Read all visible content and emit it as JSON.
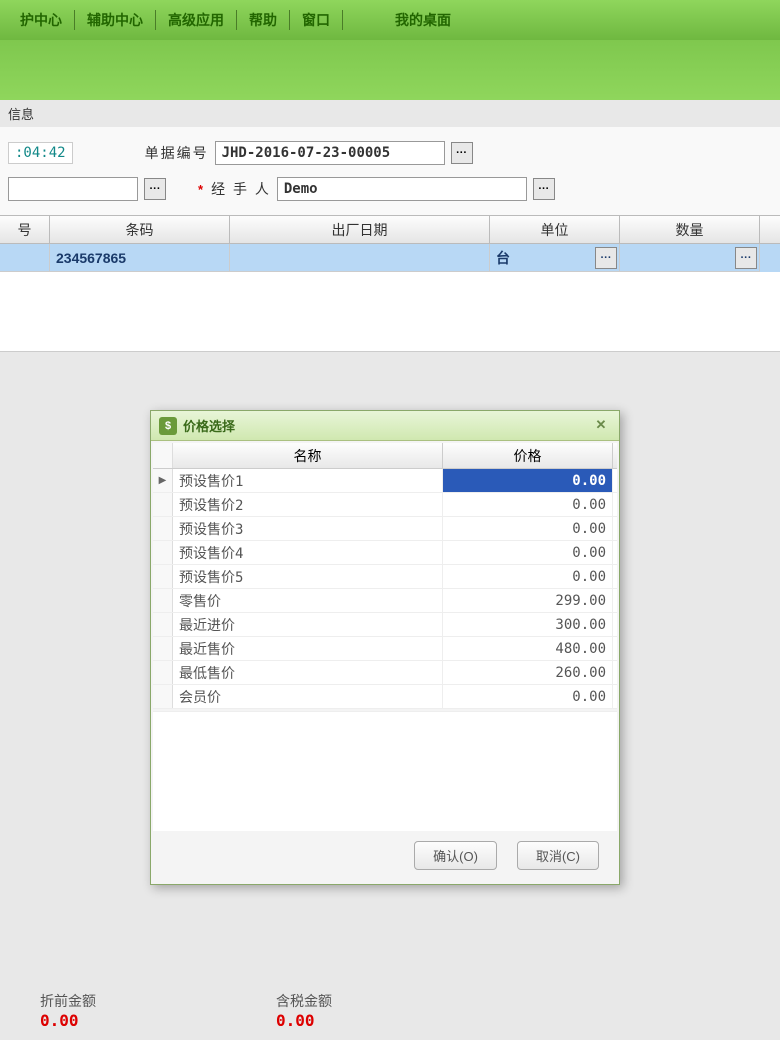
{
  "menu": {
    "items": [
      "护中心",
      "辅助中心",
      "高级应用",
      "帮助",
      "窗口",
      "我的桌面"
    ]
  },
  "info_label": "信息",
  "header": {
    "time": ":04:42",
    "doc_no_label": "单据编号",
    "doc_no_value": "JHD-2016-07-23-00005",
    "handler_label": "经 手 人",
    "handler_value": "Demo"
  },
  "grid": {
    "columns": [
      "号",
      "条码",
      "出厂日期",
      "单位",
      "数量"
    ],
    "row": {
      "barcode": "234567865",
      "mfg_date": "",
      "unit": "台",
      "qty": ""
    }
  },
  "dialog": {
    "title": "价格选择",
    "columns": [
      "名称",
      "价格"
    ],
    "rows": [
      {
        "name": "预设售价1",
        "price": "0.00",
        "selected": true
      },
      {
        "name": "预设售价2",
        "price": "0.00"
      },
      {
        "name": "预设售价3",
        "price": "0.00"
      },
      {
        "name": "预设售价4",
        "price": "0.00"
      },
      {
        "name": "预设售价5",
        "price": "0.00"
      },
      {
        "name": "零售价",
        "price": "299.00"
      },
      {
        "name": "最近进价",
        "price": "300.00"
      },
      {
        "name": "最近售价",
        "price": "480.00"
      },
      {
        "name": "最低售价",
        "price": "260.00"
      },
      {
        "name": "会员价",
        "price": "0.00"
      }
    ],
    "ok_label": "确认(O)",
    "cancel_label": "取消(C)"
  },
  "totals": {
    "pre_discount_label": "折前金额",
    "pre_discount_value": "0.00",
    "tax_incl_label": "含税金额",
    "tax_incl_value": "0.00"
  }
}
